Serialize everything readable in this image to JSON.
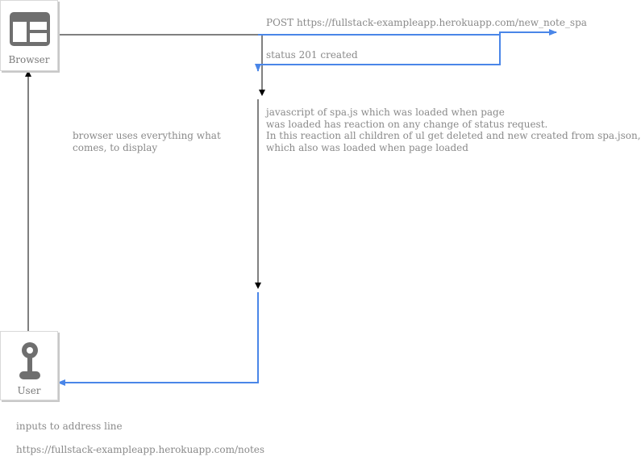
{
  "nodes": {
    "browser": {
      "label": "Browser",
      "icon": "browser-window-icon"
    },
    "user": {
      "label": "User",
      "icon": "person-icon"
    }
  },
  "labels": {
    "post_request": "POST https://fullstack-exampleapp.herokuapp.com/new_note_spa",
    "status": "status 201 created",
    "js_reaction": [
      "javascript of spa.js which was loaded when page",
      "was loaded has reaction on any change of status request.",
      "In this reaction all children of ul get deleted and new created from spa.json,",
      "which also was loaded when page loaded"
    ],
    "browser_display": [
      "browser uses everything what",
      "comes, to display"
    ],
    "user_input": "inputs to address line",
    "user_url": "https://fullstack-exampleapp.herokuapp.com/notes"
  },
  "colors": {
    "accent_line": "#4a86e8",
    "black_line": "#000000",
    "icon": "#6f6f6f",
    "text": "#8a8a8a"
  }
}
